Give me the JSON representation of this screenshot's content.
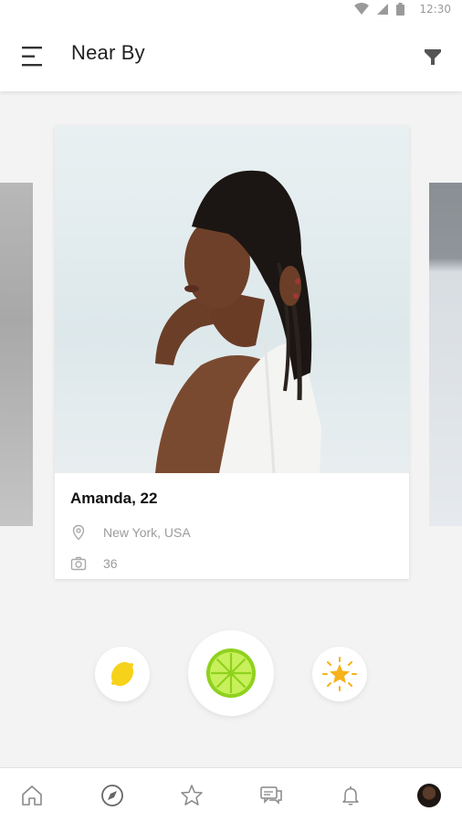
{
  "status_bar": {
    "time": "12:30"
  },
  "header": {
    "title": "Near By"
  },
  "profile": {
    "name_age": "Amanda, 22",
    "location": "New York, USA",
    "photo_count": "36"
  },
  "actions": [
    "lemon",
    "lime",
    "star"
  ],
  "colors": {
    "accent_lime": "#a6e22e",
    "lemon_yellow": "#f7d21a",
    "star_orange": "#f5b21a"
  },
  "bottom_nav": {
    "items": [
      "home-icon",
      "compass-icon",
      "star-outline-icon",
      "chat-icon",
      "bell-icon",
      "avatar"
    ]
  }
}
